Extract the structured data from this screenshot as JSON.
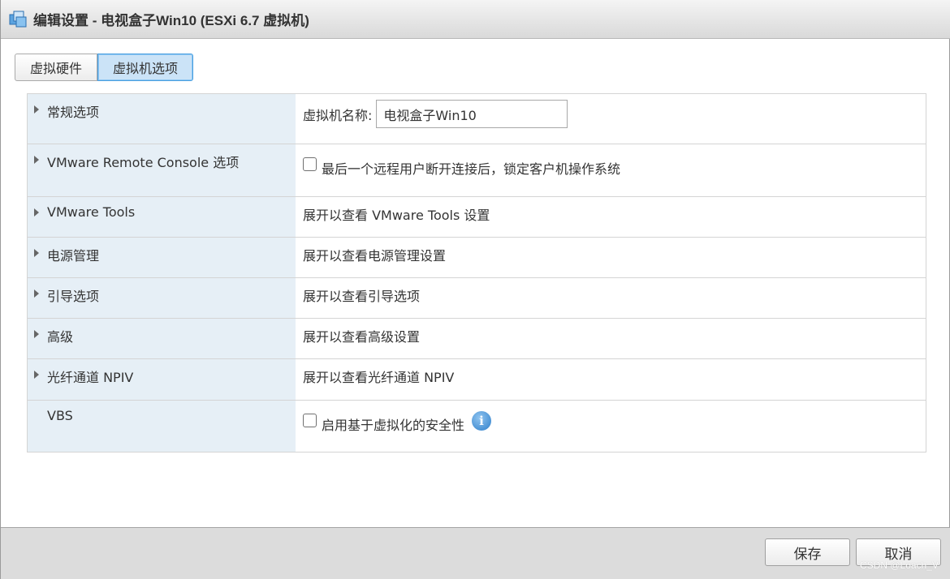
{
  "window": {
    "title": "编辑设置 - 电视盒子Win10 (ESXi 6.7 虚拟机)",
    "icon": "vm-settings-icon"
  },
  "tabs": [
    {
      "label": "虚拟硬件",
      "active": false
    },
    {
      "label": "虚拟机选项",
      "active": true
    }
  ],
  "options": {
    "general": {
      "label": "常规选项",
      "name_label": "虚拟机名称:",
      "name_value": "电视盒子Win10"
    },
    "remote_console": {
      "label": "VMware Remote Console 选项",
      "checkbox_label": "最后一个远程用户断开连接后，锁定客户机操作系统",
      "checked": false
    },
    "tools": {
      "label": "VMware Tools",
      "value": "展开以查看 VMware Tools 设置"
    },
    "power": {
      "label": "电源管理",
      "value": "展开以查看电源管理设置"
    },
    "boot": {
      "label": "引导选项",
      "value": "展开以查看引导选项"
    },
    "advanced": {
      "label": "高级",
      "value": "展开以查看高级设置"
    },
    "npiv": {
      "label": "光纤通道 NPIV",
      "value": "展开以查看光纤通道 NPIV"
    },
    "vbs": {
      "label": "VBS",
      "checkbox_label": "启用基于虚拟化的安全性",
      "checked": false,
      "info_glyph": "i"
    }
  },
  "footer": {
    "save_label": "保存",
    "cancel_label": "取消"
  },
  "watermark": "CSDN @Loach_V",
  "colors": {
    "label_column_bg": "#e6eff6",
    "active_tab_bg": "#cbe3f7",
    "active_tab_border": "#4a9fe0",
    "info_icon": "#2f7fca"
  }
}
